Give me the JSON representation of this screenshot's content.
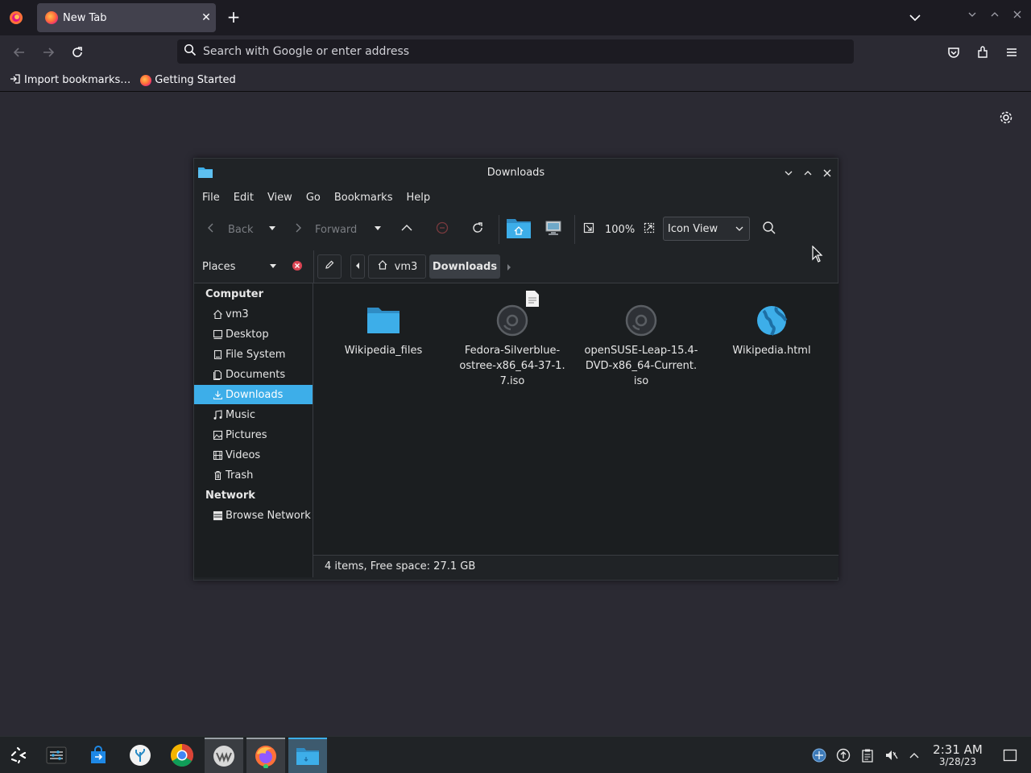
{
  "browser": {
    "tab_title": "New Tab",
    "tab_close": "✕",
    "new_tab": "+",
    "url_placeholder": "Search with Google or enter address",
    "bookmarks": [
      {
        "label": "Import bookmarks…"
      },
      {
        "label": "Getting Started"
      }
    ]
  },
  "window": {
    "title": "Downloads",
    "menu": [
      "File",
      "Edit",
      "View",
      "Go",
      "Bookmarks",
      "Help"
    ],
    "toolbar": {
      "back": "Back",
      "forward": "Forward",
      "zoom": "100%",
      "view_mode": "Icon View"
    },
    "places_label": "Places",
    "breadcrumb": [
      "vm3",
      "Downloads"
    ],
    "sidebar": {
      "sections": [
        {
          "label": "Computer",
          "items": [
            "vm3",
            "Desktop",
            "File System",
            "Documents",
            "Downloads",
            "Music",
            "Pictures",
            "Videos",
            "Trash"
          ]
        },
        {
          "label": "Network",
          "items": [
            "Browse Network"
          ]
        }
      ],
      "selected": "Downloads"
    },
    "files": [
      {
        "name": "Wikipedia_files",
        "icon": "folder-icon"
      },
      {
        "name": "Fedora-Silverblue-ostree-x86_64-37-1.7.iso",
        "lines": [
          "Fedora-Silverblue-",
          "ostree-x86_64-37-1.",
          "7.iso"
        ],
        "icon": "disc-image-icon"
      },
      {
        "name": "openSUSE-Leap-15.4-DVD-x86_64-Current.iso",
        "lines": [
          "openSUSE-Leap-15.4-",
          "DVD-x86_64-Current.",
          "iso"
        ],
        "icon": "disc-image-icon"
      },
      {
        "name": "Wikipedia.html",
        "icon": "html-globe-icon"
      }
    ],
    "status": "4 items, Free space: 27.1 GB"
  },
  "taskbar": {
    "clock_time": "2:31 AM",
    "clock_date": "3/28/23"
  },
  "colors": {
    "accent": "#3daee9",
    "window_bg": "#202326",
    "view_bg": "#1b1e20",
    "browser_bg": "#2b2a33"
  }
}
